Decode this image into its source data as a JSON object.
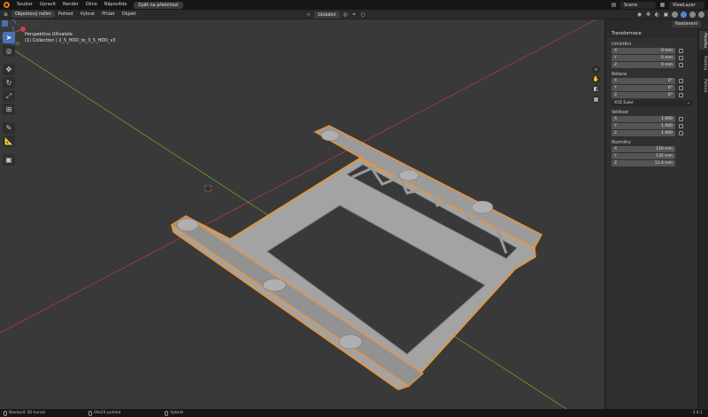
{
  "topbar": {
    "menus": [
      "Soubor",
      "Upravit",
      "Render",
      "Okno",
      "Nápověda"
    ],
    "undo_button": "Zpět na předchozí",
    "scene_label": "Scene",
    "viewlayer_label": "ViewLayer"
  },
  "header": {
    "mode": "Objektový režim",
    "menus": [
      "Pohled",
      "Vybrat",
      "Přidat",
      "Objekt"
    ],
    "orientation": "Globální",
    "options": "Nastavení"
  },
  "viewport": {
    "view_name": "Perspektiva Uživatele",
    "collection_info": "(1) Collection | 2_5_HDD_to_3_5_HDD_v3",
    "colors": {
      "background": "#393939",
      "grid": "#434343",
      "x_axis": "#a83a4b",
      "y_axis": "#6c9a2a",
      "selection": "#f0922d"
    }
  },
  "panel": {
    "section_title": "Transformace",
    "location_label": "Umístění",
    "location": [
      {
        "axis": "X",
        "value": "0 mm"
      },
      {
        "axis": "Y",
        "value": "0 mm"
      },
      {
        "axis": "Z",
        "value": "0 mm"
      }
    ],
    "rotation_label": "Rotace",
    "rotation": [
      {
        "axis": "X",
        "value": "0°"
      },
      {
        "axis": "Y",
        "value": "0°"
      },
      {
        "axis": "Z",
        "value": "0°"
      }
    ],
    "rotation_mode": "XYZ Euler",
    "scale_label": "Velikost",
    "scale": [
      {
        "axis": "X",
        "value": "1.000"
      },
      {
        "axis": "Y",
        "value": "1.000"
      },
      {
        "axis": "Z",
        "value": "1.000"
      }
    ],
    "dimensions_label": "Rozměry",
    "dimensions": [
      {
        "axis": "X",
        "value": "110 mm"
      },
      {
        "axis": "Y",
        "value": "135 mm"
      },
      {
        "axis": "Z",
        "value": "11.4 mm"
      }
    ],
    "tabs": [
      "Položka",
      "Nástroj",
      "Pohled"
    ]
  },
  "statusbar": {
    "left": "Nastavit 3D kurzor",
    "middle": "Otočit pohled",
    "right": "Vybrat",
    "version": "3.4.1"
  }
}
